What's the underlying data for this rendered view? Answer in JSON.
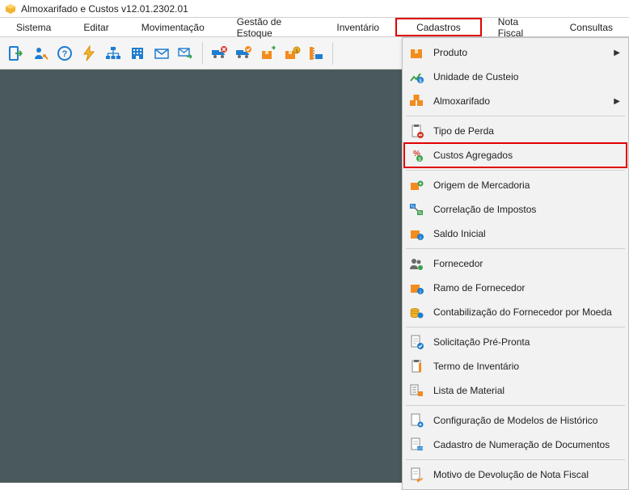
{
  "title": "Almoxarifado e Custos v12.01.2302.01",
  "menus": {
    "sistema": "Sistema",
    "editar": "Editar",
    "movimentacao": "Movimentação",
    "gestao_estoque": "Gestão de Estoque",
    "inventario": "Inventário",
    "cadastros": "Cadastros",
    "nota_fiscal": "Nota Fiscal",
    "consultas": "Consultas"
  },
  "dropdown": {
    "produto": "Produto",
    "unidade_custeio": "Unidade de Custeio",
    "almoxarifado": "Almoxarifado",
    "tipo_perda": "Tipo de Perda",
    "custos_agregados": "Custos Agregados",
    "origem_mercadoria": "Origem de Mercadoria",
    "correlacao_impostos": "Correlação de Impostos",
    "saldo_inicial": "Saldo Inicial",
    "fornecedor": "Fornecedor",
    "ramo_fornecedor": "Ramo de Fornecedor",
    "contabilizacao_fornecedor_moeda": "Contabilização do Fornecedor por Moeda",
    "solicitacao_pre_pronta": "Solicitação Pré-Pronta",
    "termo_inventario": "Termo de Inventário",
    "lista_material": "Lista de Material",
    "config_modelos_historico": "Configuração de Modelos de Histórico",
    "cadastro_numeracao_docs": "Cadastro de Numeração de Documentos",
    "motivo_devolucao_nf": "Motivo de Devolução de Nota Fiscal"
  },
  "toolbar_icons": [
    "exit-icon",
    "user-key-icon",
    "help-icon",
    "lightning-icon",
    "org-chart-icon",
    "building-icon",
    "mail-icon",
    "mail-forward-icon",
    "truck-cancel-icon",
    "truck-check-icon",
    "box-arrow-icon",
    "box-coin-icon",
    "ruler-icon"
  ]
}
